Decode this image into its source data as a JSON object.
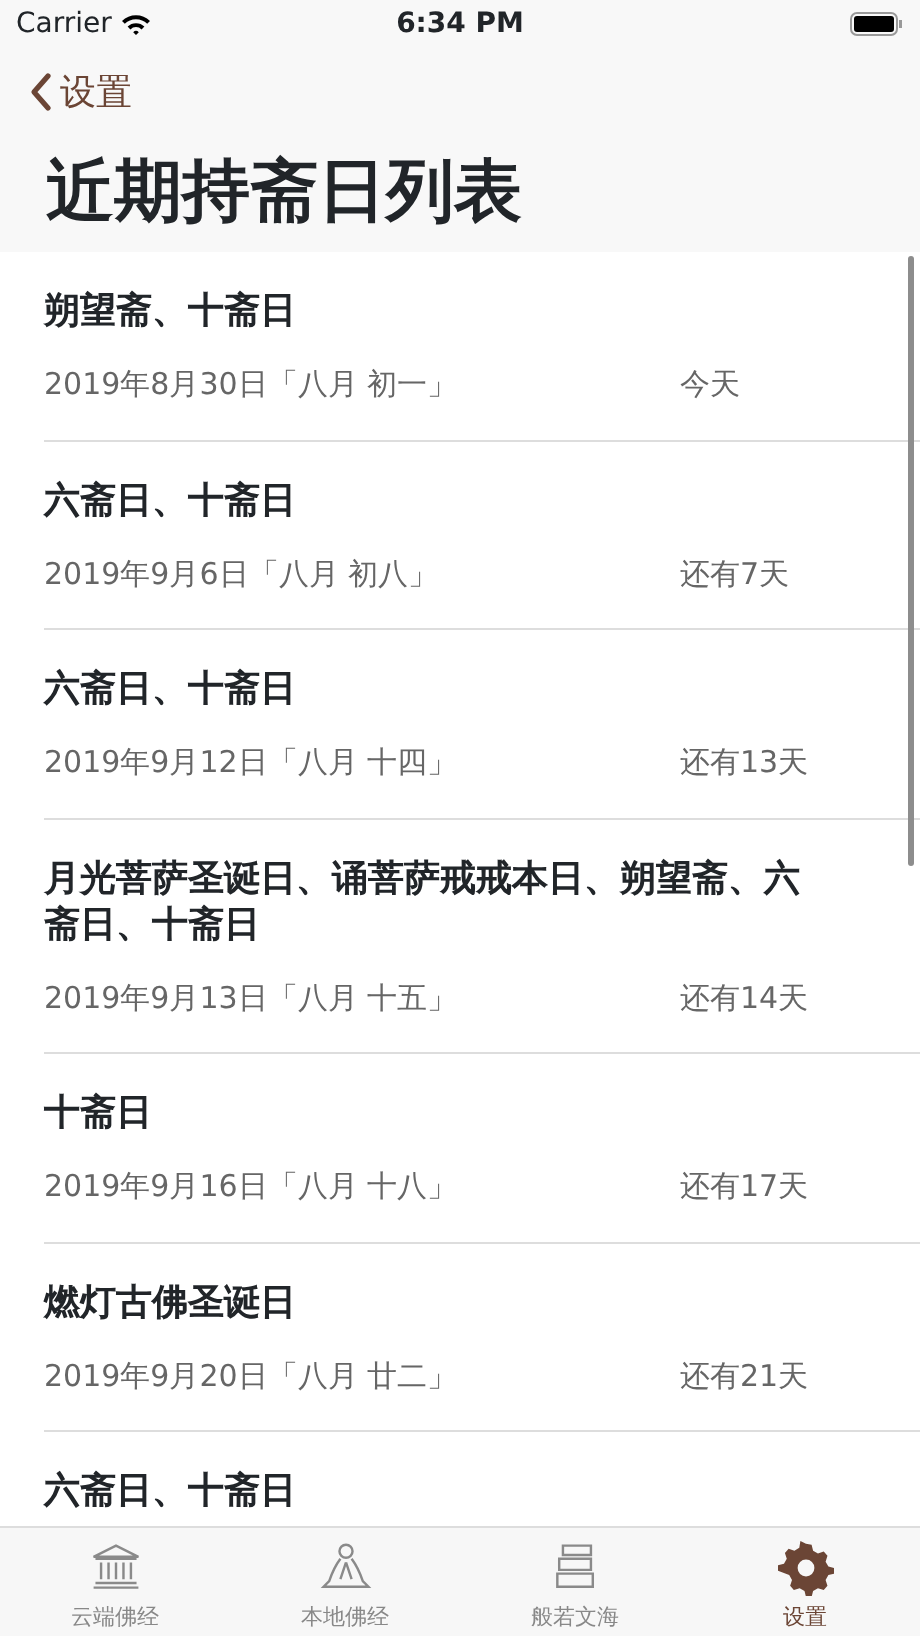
{
  "status_bar": {
    "carrier": "Carrier",
    "time": "6:34 PM"
  },
  "nav": {
    "back_label": "设置",
    "title": "近期持斋日列表"
  },
  "rows": [
    {
      "title": "朔望斋、十斋日",
      "date": "2019年8月30日「八月 初一」",
      "countdown": "今天"
    },
    {
      "title": "六斋日、十斋日",
      "date": "2019年9月6日「八月 初八」",
      "countdown": "还有7天"
    },
    {
      "title": "六斋日、十斋日",
      "date": "2019年9月12日「八月 十四」",
      "countdown": "还有13天"
    },
    {
      "title": "月光菩萨圣诞日、诵菩萨戒戒本日、朔望斋、六斋日、十斋日",
      "date": "2019年9月13日「八月 十五」",
      "countdown": "还有14天"
    },
    {
      "title": "十斋日",
      "date": "2019年9月16日「八月 十八」",
      "countdown": "还有17天"
    },
    {
      "title": "燃灯古佛圣诞日",
      "date": "2019年9月20日「八月 廿二」",
      "countdown": "还有21天"
    },
    {
      "title": "六斋日、十斋日"
    }
  ],
  "tabs": [
    {
      "label": "云端佛经",
      "selected": false
    },
    {
      "label": "本地佛经",
      "selected": false
    },
    {
      "label": "般若文海",
      "selected": false
    },
    {
      "label": "设置",
      "selected": true
    }
  ]
}
